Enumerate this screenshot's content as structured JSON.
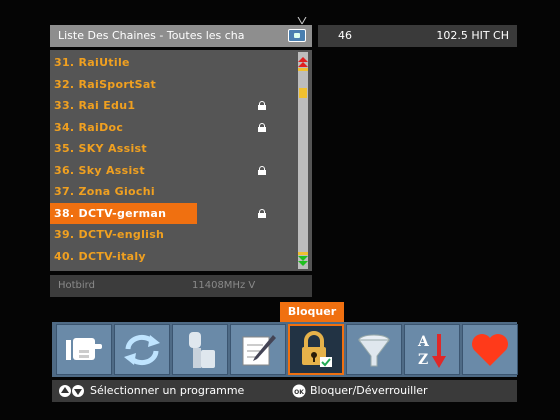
{
  "header": {
    "title": "Liste Des Chaines - Toutes les cha"
  },
  "channels": [
    {
      "label": "31. RaiUtile",
      "locked": false,
      "selected": false
    },
    {
      "label": "32. RaiSportSat",
      "locked": false,
      "selected": false
    },
    {
      "label": "33. Rai Edu1",
      "locked": true,
      "selected": false
    },
    {
      "label": "34. RaiDoc",
      "locked": true,
      "selected": false
    },
    {
      "label": "35. SKY Assist",
      "locked": false,
      "selected": false
    },
    {
      "label": "36. Sky Assist",
      "locked": true,
      "selected": false
    },
    {
      "label": "37. Zona Giochi",
      "locked": false,
      "selected": false
    },
    {
      "label": "38. DCTV-german",
      "locked": true,
      "selected": true
    },
    {
      "label": "39. DCTV-english",
      "locked": false,
      "selected": false
    },
    {
      "label": "40. DCTV-italy",
      "locked": false,
      "selected": false
    }
  ],
  "status": {
    "satellite": "Hotbird",
    "frequency": "11408MHz V"
  },
  "info": {
    "number": "46",
    "name": "102.5 HIT CH"
  },
  "toolbar": {
    "active_label": "Bloquer",
    "buttons": [
      {
        "icon": "hand-pointer-icon"
      },
      {
        "icon": "swap-arrows-icon"
      },
      {
        "icon": "move-icon"
      },
      {
        "icon": "edit-pencil-icon"
      },
      {
        "icon": "lock-icon",
        "active": true
      },
      {
        "icon": "filter-funnel-icon"
      },
      {
        "icon": "sort-az-icon"
      },
      {
        "icon": "favorite-heart-icon"
      }
    ]
  },
  "help": {
    "select_text": "Sélectionner un programme",
    "lock_text": "Bloquer/Déverrouiller"
  },
  "colors": {
    "accent": "#f07010",
    "channel_text": "#f0a020",
    "toolbar": "#4f6b86"
  }
}
